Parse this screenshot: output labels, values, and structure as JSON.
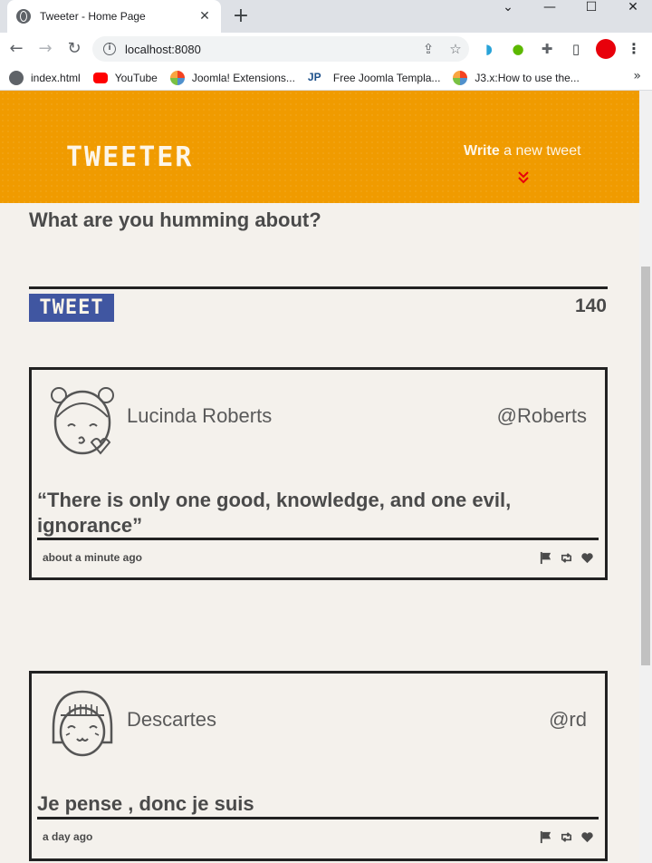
{
  "browser": {
    "tab_title": "Tweeter - Home Page",
    "url": "localhost:8080",
    "bookmarks": [
      {
        "label": "index.html",
        "icon": "globe-icon"
      },
      {
        "label": "YouTube",
        "icon": "youtube-icon"
      },
      {
        "label": "Joomla! Extensions...",
        "icon": "joomla-icon"
      },
      {
        "label": "Free Joomla Templa...",
        "icon": "jp-icon"
      },
      {
        "label": "J3.x:How to use the...",
        "icon": "joomla-icon"
      }
    ],
    "colors": {
      "profile": "#e8000b",
      "youtube": "#ff0000"
    }
  },
  "header": {
    "brand": "TWEETER",
    "compose_bold": "Write",
    "compose_rest": " a new tweet",
    "accent_color": "#f09b00"
  },
  "composer": {
    "prompt": "What are you humming about?",
    "tweet_button": "TWEET",
    "counter": "140",
    "button_color": "#4056a1"
  },
  "tweets": [
    {
      "author": "Lucinda Roberts",
      "handle": "@Roberts",
      "text": "“There is only one good, knowledge, and one evil, ignorance”",
      "time": "about a minute ago"
    },
    {
      "author": "Descartes",
      "handle": "@rd",
      "text": "Je pense , donc je suis",
      "time": "a day ago"
    }
  ]
}
